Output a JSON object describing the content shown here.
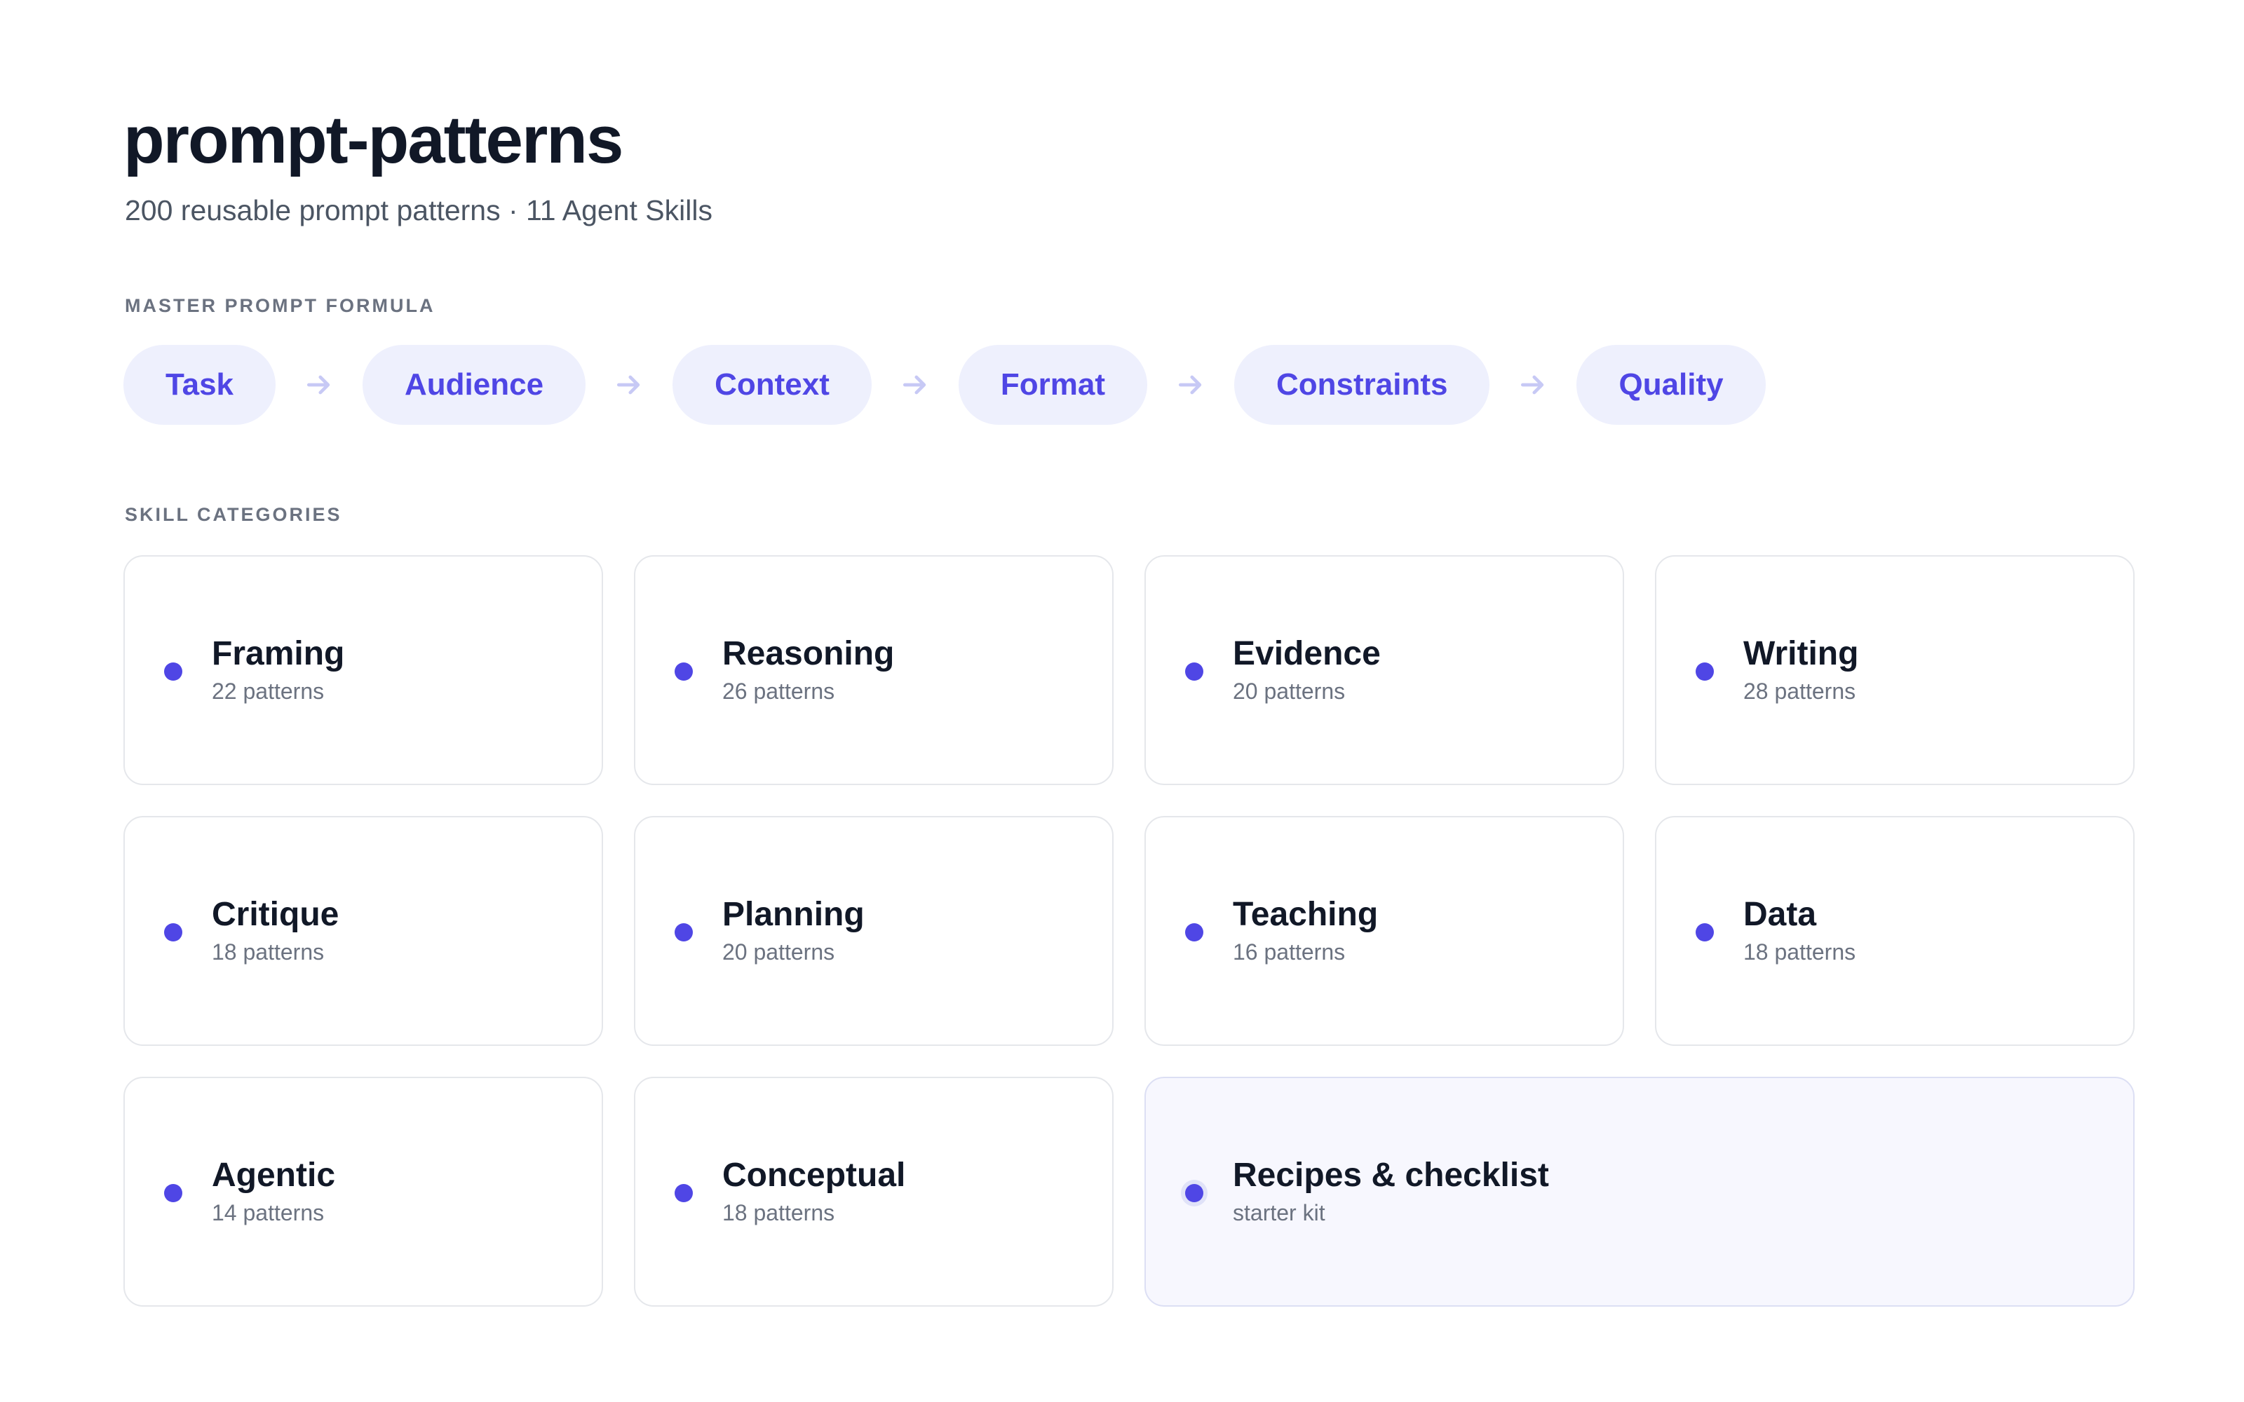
{
  "header": {
    "title": "prompt-patterns",
    "subtitle": "200 reusable prompt patterns · 11 Agent Skills"
  },
  "formula": {
    "label": "MASTER PROMPT FORMULA",
    "steps": [
      "Task",
      "Audience",
      "Context",
      "Format",
      "Constraints",
      "Quality"
    ]
  },
  "categories": {
    "label": "SKILL CATEGORIES",
    "items": [
      {
        "name": "Framing",
        "count": "22 patterns"
      },
      {
        "name": "Reasoning",
        "count": "26 patterns"
      },
      {
        "name": "Evidence",
        "count": "20 patterns"
      },
      {
        "name": "Writing",
        "count": "28 patterns"
      },
      {
        "name": "Critique",
        "count": "18 patterns"
      },
      {
        "name": "Planning",
        "count": "20 patterns"
      },
      {
        "name": "Teaching",
        "count": "16 patterns"
      },
      {
        "name": "Data",
        "count": "18 patterns"
      },
      {
        "name": "Agentic",
        "count": "14 patterns"
      },
      {
        "name": "Conceptual",
        "count": "18 patterns"
      },
      {
        "name": "Recipes & checklist",
        "count": "starter kit"
      }
    ]
  },
  "colors": {
    "accent": "#4f46e5",
    "chip_bg": "#eef0fd",
    "arrow": "#c7c9f5",
    "card_border": "#e5e7eb",
    "highlight_bg": "#f7f7fe"
  },
  "icons": {
    "step_separator": "arrow-right-icon",
    "category_marker": "dot-icon"
  }
}
